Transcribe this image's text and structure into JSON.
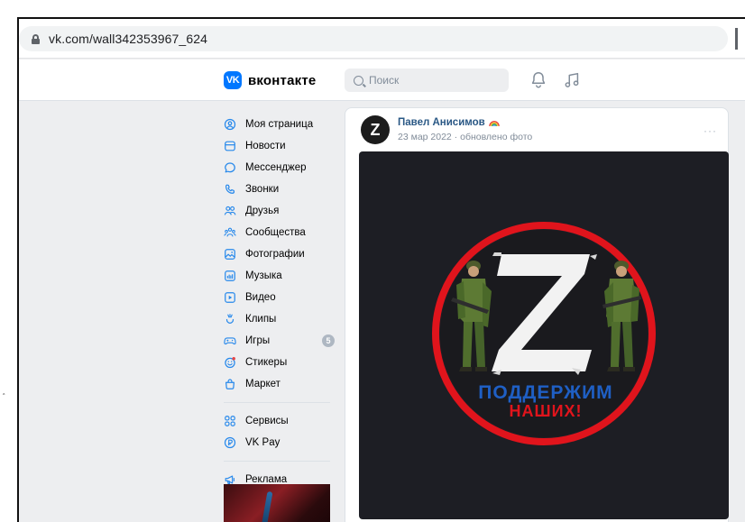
{
  "browser": {
    "url_domain": "vk.com",
    "url_path": "/wall342353967_624"
  },
  "header": {
    "logo_mark": "VK",
    "logo_text": "вконтакте",
    "search_placeholder": "Поиск"
  },
  "sidebar": {
    "items": [
      {
        "label": "Моя страница",
        "icon": "profile-icon"
      },
      {
        "label": "Новости",
        "icon": "news-icon"
      },
      {
        "label": "Мессенджер",
        "icon": "messenger-icon"
      },
      {
        "label": "Звонки",
        "icon": "phone-icon"
      },
      {
        "label": "Друзья",
        "icon": "friends-icon"
      },
      {
        "label": "Сообщества",
        "icon": "communities-icon"
      },
      {
        "label": "Фотографии",
        "icon": "photos-icon"
      },
      {
        "label": "Музыка",
        "icon": "music-icon"
      },
      {
        "label": "Видео",
        "icon": "video-icon"
      },
      {
        "label": "Клипы",
        "icon": "clips-icon"
      },
      {
        "label": "Игры",
        "icon": "games-icon",
        "badge": "5"
      },
      {
        "label": "Стикеры",
        "icon": "stickers-icon"
      },
      {
        "label": "Маркет",
        "icon": "market-icon"
      }
    ],
    "secondary": [
      {
        "label": "Сервисы",
        "icon": "services-icon"
      },
      {
        "label": "VK Pay",
        "icon": "vkpay-icon"
      }
    ],
    "ads": {
      "label": "Реклама",
      "icon": "megaphone-icon"
    }
  },
  "post": {
    "avatar_letter": "Z",
    "author": "Павел Анисимов",
    "meta": "23 мар 2022 · обновлено фото",
    "more": "···",
    "image": {
      "big_letter": "Z",
      "line1": "ПОДДЕРЖИМ",
      "line2": "НАШИХ!"
    }
  },
  "colors": {
    "vk_blue": "#0077ff",
    "link": "#2a5885",
    "ring_red": "#e0141c",
    "text_blue": "#1f5fc4",
    "text_red": "#e0141c"
  }
}
